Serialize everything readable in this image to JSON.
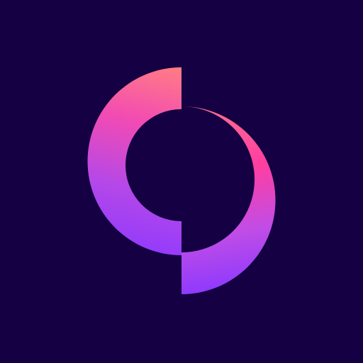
{
  "app_icon": {
    "icon_name": "brand-logo-icon",
    "background_color": "#140042",
    "gradient_left_half": {
      "top_color": "#ff7a86",
      "mid_top_color": "#f24bb3",
      "mid_bottom_color": "#b548e8",
      "bottom_color": "#8f39ff"
    },
    "gradient_right_half": {
      "top_color": "#ff7090",
      "mid_top_color": "#ff3ea0",
      "mid_bottom_color": "#c14de6",
      "bottom_color": "#8a38ff"
    }
  }
}
